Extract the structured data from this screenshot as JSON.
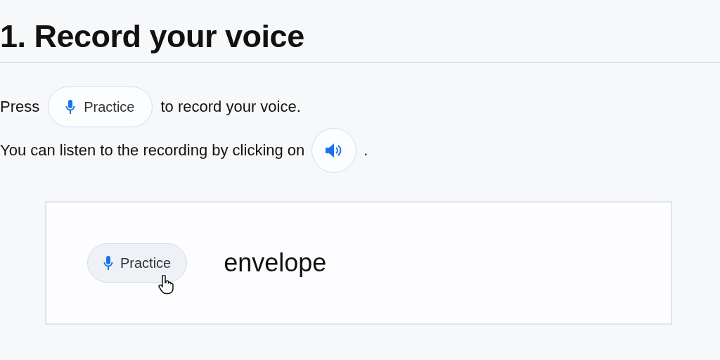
{
  "heading": "1. Record your voice",
  "instructions": [
    {
      "before": "Press",
      "button": "Practice",
      "after": "to record your voice."
    },
    {
      "before": "You can listen to the recording by clicking on",
      "after": "."
    }
  ],
  "demo": {
    "button": {
      "label": "Practice",
      "hovered": true
    },
    "word": "envelope"
  }
}
